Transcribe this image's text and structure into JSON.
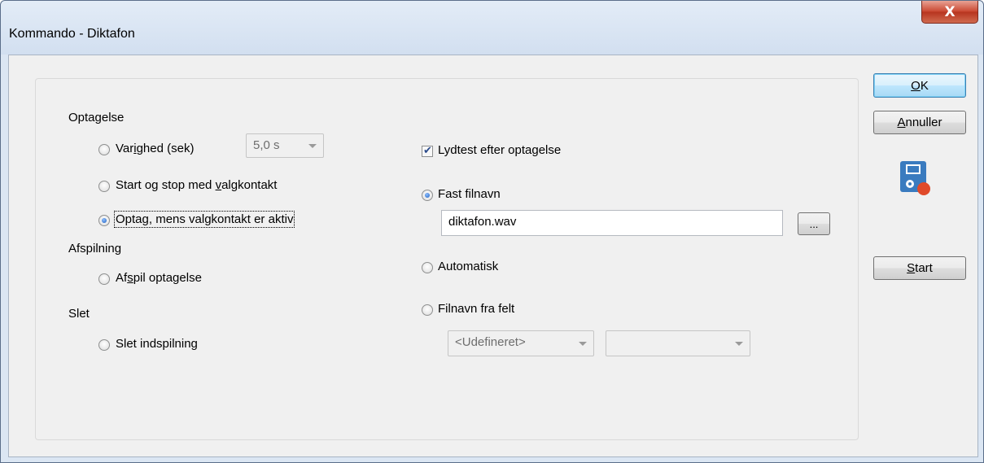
{
  "window": {
    "title": "Kommando - Diktafon",
    "close_label": "X"
  },
  "recording": {
    "heading": "Optagelse",
    "duration_label_pre": "Var",
    "duration_label_u": "i",
    "duration_label_post": "ghed (sek)",
    "duration_value": "5,0 s",
    "startstop_label_pre": "Start og stop med ",
    "startstop_label_u": "v",
    "startstop_label_post": "algkontakt",
    "while_active_label": "Optag, mens valgkontakt er aktiv"
  },
  "playback": {
    "heading": "Afspilning",
    "play_label_pre": "Af",
    "play_label_u": "s",
    "play_label_post": "pil optagelse"
  },
  "delete": {
    "heading": "Slet",
    "delete_label": "Slet indspilning"
  },
  "file": {
    "soundtest_label": "Lydtest efter optagelse",
    "fixed_label": "Fast filnavn",
    "filename_value": "diktafon.wav",
    "browse_label": "...",
    "auto_label": "Automatisk",
    "from_field_label": "Filnavn fra felt",
    "field_combo1_value": "<Udefineret>",
    "field_combo2_value": ""
  },
  "buttons": {
    "ok_u": "O",
    "ok_rest": "K",
    "cancel_u": "A",
    "cancel_rest": "nnuller",
    "start_u": "S",
    "start_rest": "tart"
  },
  "colors": {
    "recorder_icon_blue": "#3a7bbf",
    "recorder_icon_red": "#e04a2a"
  },
  "icons": {
    "recorder": "dictaphone-recorder-icon",
    "close": "close-icon"
  }
}
